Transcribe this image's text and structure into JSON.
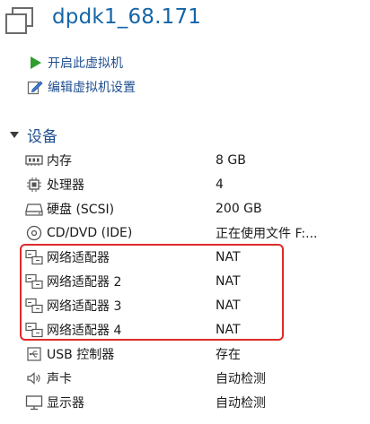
{
  "vm": {
    "title": "dpdk1_68.171"
  },
  "actions": [
    {
      "label": "开启此虚拟机",
      "icon": "play-icon"
    },
    {
      "label": "编辑虚拟机设置",
      "icon": "edit-settings-icon"
    }
  ],
  "devices_section": {
    "label": "设备",
    "icon": "collapse-triangle-icon"
  },
  "devices": [
    {
      "name": "内存",
      "value": "8 GB",
      "icon": "memory-icon"
    },
    {
      "name": "处理器",
      "value": "4",
      "icon": "cpu-icon"
    },
    {
      "name": "硬盘 (SCSI)",
      "value": "200 GB",
      "icon": "hard-disk-icon"
    },
    {
      "name": "CD/DVD (IDE)",
      "value": "正在使用文件 F:...",
      "icon": "cd-dvd-icon"
    },
    {
      "name": "网络适配器",
      "value": "NAT",
      "icon": "network-adapter-icon"
    },
    {
      "name": "网络适配器 2",
      "value": "NAT",
      "icon": "network-adapter-icon"
    },
    {
      "name": "网络适配器 3",
      "value": "NAT",
      "icon": "network-adapter-icon"
    },
    {
      "name": "网络适配器 4",
      "value": "NAT",
      "icon": "network-adapter-icon"
    },
    {
      "name": "USB 控制器",
      "value": "存在",
      "icon": "usb-icon"
    },
    {
      "name": "声卡",
      "value": "自动检测",
      "icon": "speaker-icon"
    },
    {
      "name": "显示器",
      "value": "自动检测",
      "icon": "monitor-icon"
    }
  ],
  "colors": {
    "title": "#1565a8",
    "link": "#1f4f8f",
    "highlight": "#e02a2a",
    "play": "#2e9e2e"
  }
}
